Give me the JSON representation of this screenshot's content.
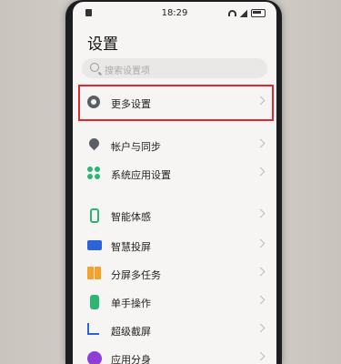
{
  "status": {
    "time": "18:29"
  },
  "page": {
    "title": "设置"
  },
  "search": {
    "placeholder": "搜索设置项"
  },
  "menu": [
    {
      "label": "更多设置",
      "icon": "gear-icon"
    },
    {
      "label": "帐户与同步",
      "icon": "location-pin-icon"
    },
    {
      "label": "系统应用设置",
      "icon": "clover-icon"
    },
    {
      "label": "智能体感",
      "icon": "phone-sense-icon"
    },
    {
      "label": "智慧投屏",
      "icon": "screen-cast-icon"
    },
    {
      "label": "分屏多任务",
      "icon": "split-screen-icon"
    },
    {
      "label": "单手操作",
      "icon": "one-hand-icon"
    },
    {
      "label": "超级截屏",
      "icon": "crop-icon"
    },
    {
      "label": "应用分身",
      "icon": "app-clone-icon"
    }
  ],
  "colors": {
    "highlight": "#e0282e",
    "green": "#2bb673",
    "blue": "#2b63d9",
    "orange": "#f3a22b",
    "purple": "#8e3fd6"
  }
}
